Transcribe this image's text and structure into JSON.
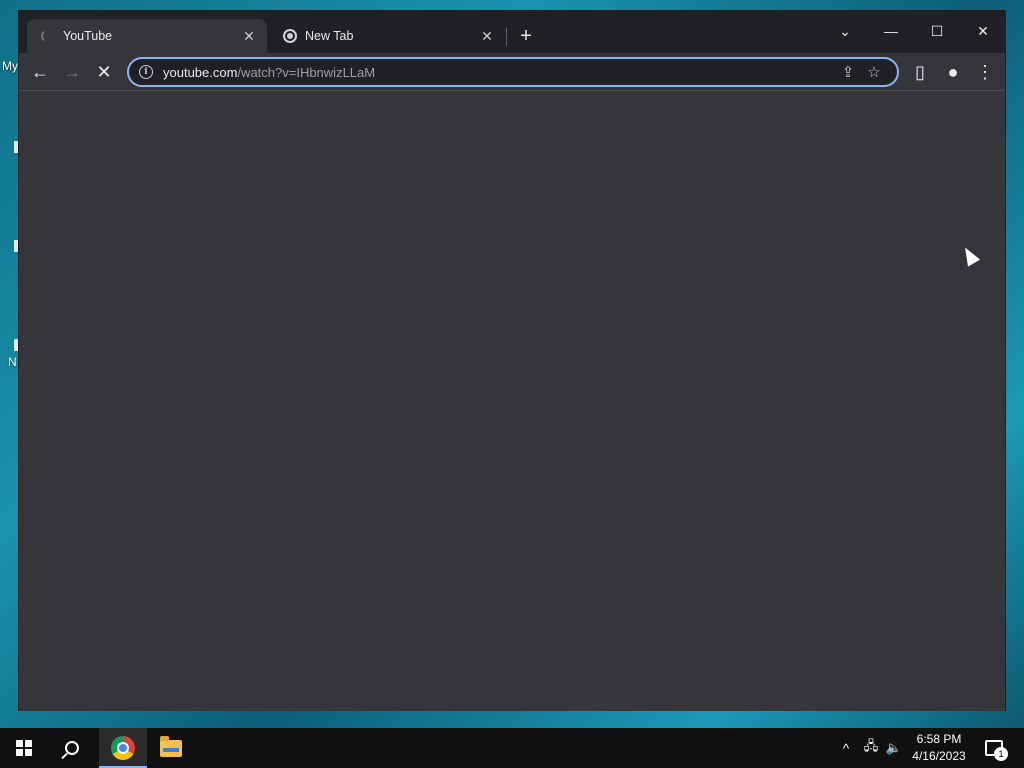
{
  "desktop": {
    "icon_label_fragment_1": "My",
    "icon_label_fragment_2": "N"
  },
  "browser": {
    "tabs": [
      {
        "title": "YouTube",
        "icon": "loading-spinner-icon",
        "state": "active-loading"
      },
      {
        "title": "New Tab",
        "icon": "chrome-icon",
        "state": "inactive"
      }
    ],
    "new_tab_symbol": "+",
    "window_controls": {
      "tab_search": "⌄",
      "minimize": "—",
      "maximize": "☐",
      "close": "✕"
    },
    "toolbar": {
      "back_symbol": "←",
      "forward_symbol": "→",
      "stop_symbol": "✕",
      "url_host": "youtube.com",
      "url_path": "/watch?v=IHbnwizLLaM",
      "site_info_symbol": "i",
      "share_symbol": "⇪",
      "bookmark_symbol": "☆",
      "side_panel_symbol": "▯",
      "profile_symbol": "●",
      "menu_symbol": "⋮"
    },
    "accent_color": "#8ab4f8"
  },
  "taskbar": {
    "clock_time": "6:58 PM",
    "clock_date": "4/16/2023",
    "tray_chevron": "^",
    "notification_count": "1"
  }
}
